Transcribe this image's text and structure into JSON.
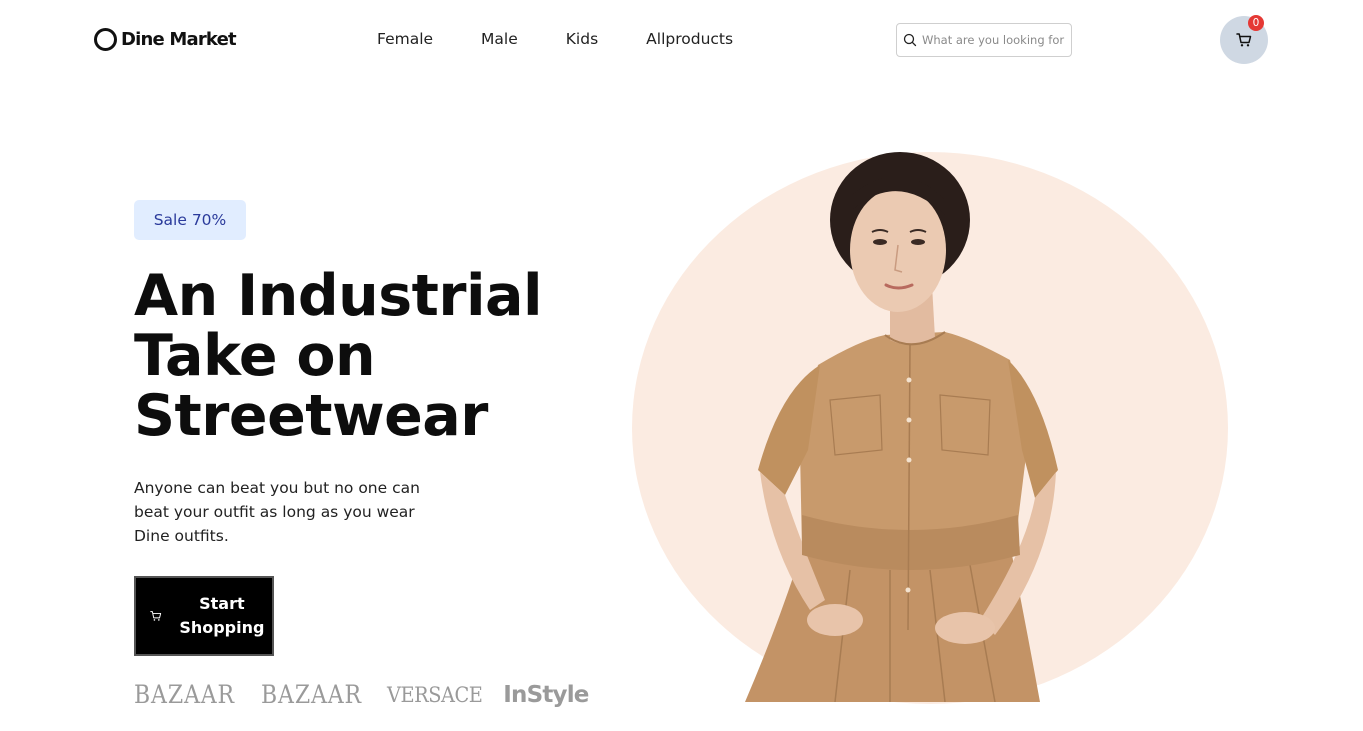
{
  "header": {
    "logo_text": "Dine Market",
    "nav": [
      "Female",
      "Male",
      "Kids",
      "Allproducts"
    ],
    "search_placeholder": "What are you looking for",
    "cart_count": "0"
  },
  "hero": {
    "badge": "Sale 70%",
    "title": "An Industrial Take on Streetwear",
    "description": "Anyone can beat you but no one can beat your outfit as long as you wear Dine outfits.",
    "cta_label": "Start Shopping",
    "brands": [
      "BAZAAR",
      "BAZAAR",
      "VERSACE",
      "InStyle"
    ]
  },
  "colors": {
    "badge_bg": "#e1edff",
    "badge_text": "#2a3a9b",
    "circle_bg": "#fbebe1",
    "cart_bg": "#cfd8e3",
    "cart_badge": "#e53935",
    "dress": "#c89a6c"
  },
  "icons": {
    "search": "search-icon",
    "cart": "cart-icon",
    "cta": "cart-icon"
  }
}
